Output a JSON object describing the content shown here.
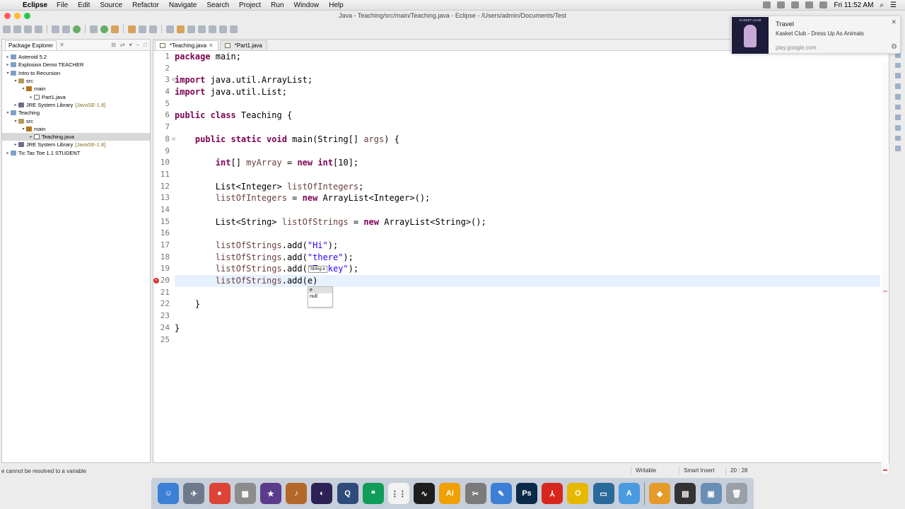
{
  "menubar": {
    "app_name": "Eclipse",
    "items": [
      "File",
      "Edit",
      "Source",
      "Refactor",
      "Navigate",
      "Search",
      "Project",
      "Run",
      "Window",
      "Help"
    ],
    "clock": "Fri 11:52 AM"
  },
  "window": {
    "title": "Java - Teaching/src/main/Teaching.java - Eclipse - /Users/admin/Documents/Test"
  },
  "package_explorer": {
    "tab_label": "Package Explorer",
    "tree": [
      {
        "label": "Asteroid 5.2",
        "twisty": "▸",
        "icon": "proj",
        "indent": 0
      },
      {
        "label": "Explosion Demo TEACHER",
        "twisty": "▸",
        "icon": "proj",
        "indent": 0
      },
      {
        "label": "Intro to Recursion",
        "twisty": "▾",
        "icon": "proj",
        "indent": 0
      },
      {
        "label": "src",
        "twisty": "▾",
        "icon": "src",
        "indent": 1
      },
      {
        "label": "main",
        "twisty": "▾",
        "icon": "pkg",
        "indent": 2
      },
      {
        "label": "Part1.java",
        "twisty": "▸",
        "icon": "file",
        "indent": 3
      },
      {
        "label": "JRE System Library",
        "suffix": "[JavaSE-1.8]",
        "twisty": "▸",
        "icon": "lib",
        "indent": 1
      },
      {
        "label": "Teaching",
        "twisty": "▾",
        "icon": "proj",
        "indent": 0
      },
      {
        "label": "src",
        "twisty": "▾",
        "icon": "src",
        "indent": 1
      },
      {
        "label": "main",
        "twisty": "▾",
        "icon": "pkg",
        "indent": 2
      },
      {
        "label": "Teaching.java",
        "twisty": "▸",
        "icon": "file",
        "indent": 3,
        "selected": true
      },
      {
        "label": "JRE System Library",
        "suffix": "[JavaSE-1.8]",
        "twisty": "▸",
        "icon": "lib",
        "indent": 1
      },
      {
        "label": "Tic Tac Toe 1.1 STUDENT",
        "twisty": "▸",
        "icon": "proj",
        "indent": 0
      }
    ]
  },
  "editor": {
    "tabs": [
      {
        "label": "*Teaching.java",
        "active": true
      },
      {
        "label": "*Part1.java",
        "active": false
      }
    ],
    "current_line": 20,
    "error_line": 20,
    "lines": [
      {
        "n": "1",
        "html": "<span class=\"kw\">package</span> main;"
      },
      {
        "n": "2",
        "html": ""
      },
      {
        "n": "3",
        "html": "<span class=\"kw\">import</span> java.util.ArrayList;"
      },
      {
        "n": "4",
        "html": "<span class=\"kw\">import</span> java.util.List;"
      },
      {
        "n": "5",
        "html": ""
      },
      {
        "n": "6",
        "html": "<span class=\"kw\">public class</span> Teaching {"
      },
      {
        "n": "7",
        "html": ""
      },
      {
        "n": "8",
        "html": "    <span class=\"kw\">public static void</span> main(String[] <span class=\"param\">args</span>) {"
      },
      {
        "n": "9",
        "html": ""
      },
      {
        "n": "10",
        "html": "        <span class=\"kw\">int</span>[] <span class=\"param\">myArray</span> = <span class=\"kw\">new int</span>[10];"
      },
      {
        "n": "11",
        "html": ""
      },
      {
        "n": "12",
        "html": "        List&lt;Integer&gt; <span class=\"param\">listOfIntegers</span>;"
      },
      {
        "n": "13",
        "html": "        <span class=\"param\">listOfIntegers</span> = <span class=\"kw\">new</span> ArrayList&lt;Integer&gt;();"
      },
      {
        "n": "14",
        "html": ""
      },
      {
        "n": "15",
        "html": "        List&lt;String&gt; <span class=\"param\">listOfStrings</span> = <span class=\"kw\">new</span> ArrayList&lt;String&gt;();"
      },
      {
        "n": "16",
        "html": ""
      },
      {
        "n": "17",
        "html": "        <span class=\"param\">listOfStrings</span>.add(<span class=\"str\">\"Hi\"</span>);"
      },
      {
        "n": "18",
        "html": "        <span class=\"param\">listOfStrings</span>.add(<span class=\"str\">\"there\"</span>);"
      },
      {
        "n": "19",
        "html": "        <span class=\"param\">listOfStrings</span>.add(<span class=\"str\">\"Turkey\"</span>);"
      },
      {
        "n": "20",
        "html": "        <span class=\"param\">listOfStrings</span>.add(e)"
      },
      {
        "n": "21",
        "html": ""
      },
      {
        "n": "22",
        "html": "    }"
      },
      {
        "n": "23",
        "html": ""
      },
      {
        "n": "24",
        "html": "}"
      },
      {
        "n": "25",
        "html": ""
      }
    ],
    "param_tooltip": "String e",
    "completion_items": [
      "e",
      "null"
    ]
  },
  "statusbar": {
    "message": "e cannot be resolved to a variable",
    "mode": "Writable",
    "insert_mode": "Smart Insert",
    "position": "20 : 28"
  },
  "notification": {
    "title": "Travel",
    "subtitle": "Kasket Club - Dress Up As Animals",
    "source": "play.google.com",
    "image_caption": "KASKET CLUB"
  },
  "dock": {
    "apps": [
      {
        "name": "finder-app",
        "color": "#3b7fd6",
        "glyph": "☺"
      },
      {
        "name": "launchpad-app",
        "color": "#6e7a8c",
        "glyph": "✈"
      },
      {
        "name": "chrome-app",
        "color": "#db4437",
        "glyph": "●"
      },
      {
        "name": "calculator-app",
        "color": "#8c8c8c",
        "glyph": "▦"
      },
      {
        "name": "imovie-app",
        "color": "#5b3c8c",
        "glyph": "★"
      },
      {
        "name": "garageband-app",
        "color": "#b3682a",
        "glyph": "♪"
      },
      {
        "name": "eclipse-app",
        "color": "#2c2255",
        "glyph": "◐"
      },
      {
        "name": "quicktime-app",
        "color": "#2f4b7a",
        "glyph": "Q"
      },
      {
        "name": "hangouts-app",
        "color": "#0f9d58",
        "glyph": "❝"
      },
      {
        "name": "apps-grid-app",
        "color": "#f2f2f2",
        "glyph": "⋮⋮"
      },
      {
        "name": "activity-monitor-app",
        "color": "#1d1d1d",
        "glyph": "∿"
      },
      {
        "name": "illustrator-app",
        "color": "#f0a000",
        "glyph": "Ai"
      },
      {
        "name": "utilities-app",
        "color": "#7a7a7a",
        "glyph": "✂"
      },
      {
        "name": "textedit-app",
        "color": "#3b7fd6",
        "glyph": "✎"
      },
      {
        "name": "photoshop-app",
        "color": "#0b2a4a",
        "glyph": "Ps"
      },
      {
        "name": "acrobat-app",
        "color": "#d7261e",
        "glyph": "⅄"
      },
      {
        "name": "growl-app",
        "color": "#e6b800",
        "glyph": "O"
      },
      {
        "name": "screen-app",
        "color": "#2a6a9a",
        "glyph": "▭"
      },
      {
        "name": "app-store-app",
        "color": "#4a9ae0",
        "glyph": "A"
      },
      {
        "name": "archive-app",
        "color": "#e59a2a",
        "glyph": "◆"
      },
      {
        "name": "terminal-app",
        "color": "#333",
        "glyph": "▤"
      },
      {
        "name": "preview-app",
        "color": "#6a8fb5",
        "glyph": "▣"
      },
      {
        "name": "trash-app",
        "color": "#9aa0a8",
        "glyph": "🗑"
      }
    ]
  }
}
